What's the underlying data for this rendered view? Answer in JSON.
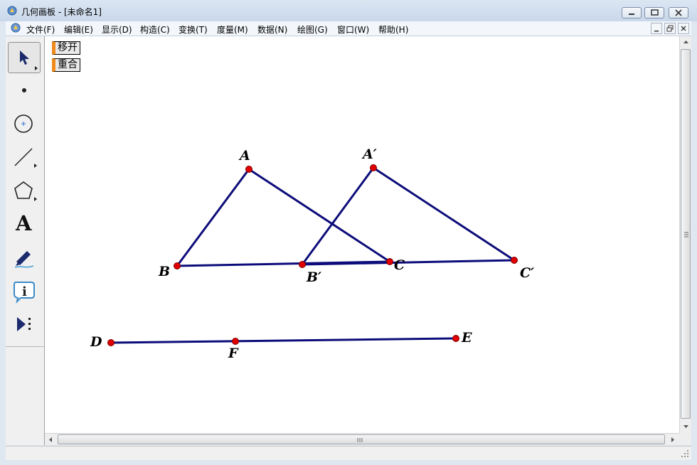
{
  "window": {
    "title": "几何画板 - [未命名1]",
    "controls": [
      "minimize-icon",
      "restore-icon",
      "close-icon"
    ]
  },
  "menu": {
    "items": [
      {
        "label": "文件(F)"
      },
      {
        "label": "编辑(E)"
      },
      {
        "label": "显示(D)"
      },
      {
        "label": "构造(C)"
      },
      {
        "label": "变换(T)"
      },
      {
        "label": "度量(M)"
      },
      {
        "label": "数据(N)"
      },
      {
        "label": "绘图(G)"
      },
      {
        "label": "窗口(W)"
      },
      {
        "label": "帮助(H)"
      }
    ],
    "mdi_controls": [
      "minimize-icon",
      "restore-icon",
      "close-icon"
    ]
  },
  "toolbox": {
    "tools": [
      {
        "name": "selection-arrow-tool",
        "icon": "arrow-cursor-icon",
        "active": true
      },
      {
        "name": "point-tool",
        "icon": "point-icon",
        "active": false
      },
      {
        "name": "compass-tool",
        "icon": "circle-icon",
        "active": false
      },
      {
        "name": "straightedge-tool",
        "icon": "segment-icon",
        "active": false
      },
      {
        "name": "polygon-tool",
        "icon": "pentagon-icon",
        "active": false
      },
      {
        "name": "text-tool",
        "icon": "text-A-icon",
        "label": "A",
        "active": false
      },
      {
        "name": "marker-tool",
        "icon": "marker-pen-icon",
        "active": false
      },
      {
        "name": "information-tool",
        "icon": "info-icon",
        "label": "i",
        "active": false
      },
      {
        "name": "custom-tool",
        "icon": "play-more-icon",
        "active": false
      }
    ]
  },
  "canvas": {
    "buttons": [
      {
        "label": "移开"
      },
      {
        "label": "重合"
      }
    ],
    "points": [
      {
        "id": "A",
        "label": "A"
      },
      {
        "id": "B",
        "label": "B"
      },
      {
        "id": "C",
        "label": "C"
      },
      {
        "id": "A1",
        "label": "A′"
      },
      {
        "id": "B1",
        "label": "B′"
      },
      {
        "id": "C1",
        "label": "C′"
      },
      {
        "id": "D",
        "label": "D"
      },
      {
        "id": "E",
        "label": "E"
      },
      {
        "id": "F",
        "label": "F"
      }
    ],
    "segments": [
      [
        "A",
        "B"
      ],
      [
        "A",
        "C"
      ],
      [
        "B",
        "C"
      ],
      [
        "A1",
        "B1"
      ],
      [
        "A1",
        "C1"
      ],
      [
        "B1",
        "C1"
      ],
      [
        "D",
        "E"
      ]
    ]
  },
  "colors": {
    "segment": "#0c0c7a",
    "point_fill": "#e00000",
    "point_stroke": "#7a0000",
    "button_accent": "#f08a1c"
  }
}
